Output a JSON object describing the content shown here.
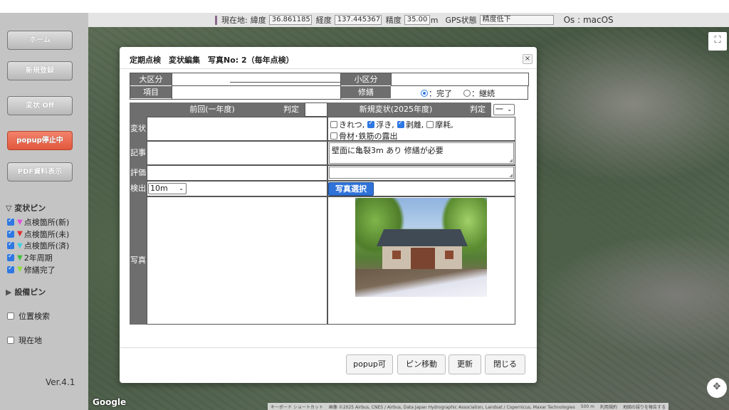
{
  "topbar": {
    "location_label": "現在地:",
    "lat_label": "緯度",
    "lat_value": "36.861185",
    "lng_label": "経度",
    "lng_value": "137.445367",
    "accuracy_label": "精度",
    "accuracy_value": "35.00",
    "accuracy_unit": "m",
    "gps_label": "GPS状態",
    "gps_value": "精度低下",
    "os_text": "Os : macOS"
  },
  "sidebar": {
    "home": "ホーム",
    "new_register": "新規登録",
    "anomaly_toggle": "変状 Off",
    "popup_stop": "popup停止中",
    "pdf_show": "PDF資料表示",
    "anomaly_pins_header": "変状ピン",
    "anomaly_pins_toggle": "▽",
    "pins": [
      {
        "label": "点検箇所(新)",
        "color": "#e04fd8",
        "checked": true
      },
      {
        "label": "点検箇所(未)",
        "color": "#e03030",
        "checked": true
      },
      {
        "label": "点検箇所(済)",
        "color": "#3fd0e0",
        "checked": true
      },
      {
        "label": "2年周期",
        "color": "#3fbf3f",
        "checked": true
      },
      {
        "label": "修繕完了",
        "color": "#8fe03f",
        "checked": true
      }
    ],
    "facility_pins_header": "設備ピン",
    "facility_pins_toggle": "▶",
    "location_search": "位置検索",
    "current_location": "現在地",
    "version": "Ver.4.1"
  },
  "map": {
    "brand": "Google",
    "attribution": [
      "キーボード ショートカット",
      "画像 ©2025 Airbus, CNES / Airbus, Data Japan Hydrographic Association, Landsat / Copernicus, Maxar Technologies",
      "500 m",
      "利用規約",
      "地図の誤りを報告する"
    ],
    "fullscreen_icon": "⛶",
    "compass_icon": "✥"
  },
  "dialog": {
    "title": "定期点検　変状編集　写真No: 2（毎年点検）",
    "close_icon": "×",
    "major_class_label": "大区分",
    "minor_class_label": "小区分",
    "item_label": "項目",
    "repair_label": "修繕",
    "repair_options": [
      "：完了",
      "：継続"
    ],
    "repair_selected": 0,
    "prev_header": "前回(一年度)",
    "judge_label": "判定",
    "new_header": "新規変状(2025年度)",
    "new_judge_label": "判定",
    "new_judge_value": "一",
    "anomaly_label": "変状",
    "anomaly_checks": [
      {
        "label": "きれつ,",
        "checked": false
      },
      {
        "label": "浮き,",
        "checked": true
      },
      {
        "label": "剥離,",
        "checked": true
      },
      {
        "label": "摩耗,",
        "checked": false
      },
      {
        "label": "骨材･鉄筋の露出",
        "checked": false
      }
    ],
    "notes_label": "記事",
    "notes_value": "壁面に亀裂3m あり 修繕が必要",
    "evaluation_label": "評価",
    "detect_label": "検出",
    "detect_value": "10m",
    "photo_select": "写真選択",
    "photo_label": "写真",
    "buttons": {
      "popup_enable": "popup可",
      "pin_move": "ピン移動",
      "update": "更新",
      "close": "閉じる"
    }
  }
}
